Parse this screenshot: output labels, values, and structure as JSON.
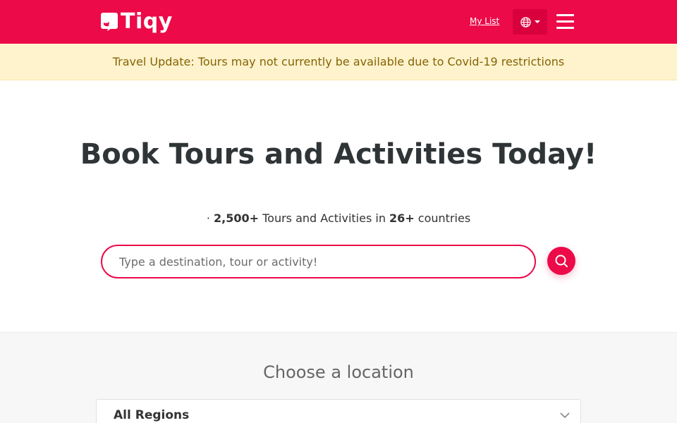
{
  "header": {
    "logo_text": "Tiqy",
    "my_list_label": "My List",
    "language_icon": "globe-icon",
    "menu_icon": "hamburger-menu-icon",
    "brand_color": "#ec0a49"
  },
  "banner": {
    "text": "Travel Update: Tours may not currently be available due to Covid-19 restrictions"
  },
  "hero": {
    "title": "Book Tours and Activities Today!",
    "sub_prefix": "· ",
    "tours_count": "2,500+",
    "sub_middle": " Tours and Activities in ",
    "countries_count": "26+",
    "sub_suffix": " countries",
    "search_placeholder": "Type a destination, tour or activity!",
    "search_icon": "search-icon"
  },
  "location": {
    "title": "Choose a location",
    "selected_region": "All Regions",
    "chevron_icon": "chevron-down-icon"
  }
}
